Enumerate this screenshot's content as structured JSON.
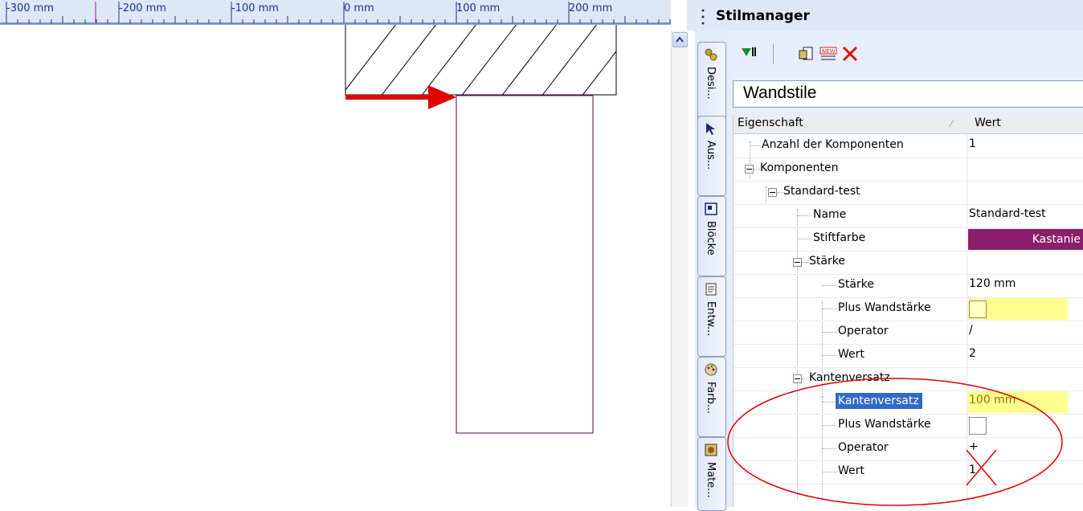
{
  "ruler": {
    "labels": [
      "-300 mm",
      "-200 mm",
      "-100 mm",
      "0 mm",
      "100 mm",
      "200 mm"
    ]
  },
  "scrollbar": {
    "up_icon": "chevron-up-icon"
  },
  "side_tabs": [
    {
      "label": "Desi...",
      "icon": "gears-icon"
    },
    {
      "label": "Aus...",
      "icon": "cursor-icon"
    },
    {
      "label": "Blöcke",
      "icon": "blocks-icon"
    },
    {
      "label": "Entw...",
      "icon": "document-icon"
    },
    {
      "label": "Farb...",
      "icon": "palette-icon"
    },
    {
      "label": "Mate...",
      "icon": "material-icon"
    }
  ],
  "panel": {
    "title": "Stilmanager",
    "style_name": "Wandstile",
    "toolbar": [
      "filter-icon",
      "new-style-icon",
      "rename-icon",
      "delete-icon"
    ]
  },
  "grid": {
    "col_property": "Eigenschaft",
    "col_value": "Wert",
    "rows": [
      {
        "name": "Anzahl der Komponenten",
        "value": "1"
      },
      {
        "name": "Komponenten",
        "value": ""
      },
      {
        "name": "Standard-test",
        "value": ""
      },
      {
        "name": "Name",
        "value": "Standard-test"
      },
      {
        "name": "Stiftfarbe",
        "value": "Kastanie"
      },
      {
        "name": "Stärke",
        "value": ""
      },
      {
        "name": "Stärke",
        "value": "120 mm"
      },
      {
        "name": "Plus Wandstärke",
        "value": ""
      },
      {
        "name": "Operator",
        "value": "/"
      },
      {
        "name": "Wert",
        "value": "2"
      },
      {
        "name": "Kantenversatz",
        "value": ""
      },
      {
        "name": "Kantenversatz",
        "value": "100 mm"
      },
      {
        "name": "Plus Wandstärke",
        "value": ""
      },
      {
        "name": "Operator",
        "value": "+"
      },
      {
        "name": "Wert",
        "value": "1"
      }
    ]
  },
  "colors": {
    "selection": "#316ac5",
    "highlight": "#ffff90",
    "annotation_red": "#e00000",
    "wall_outline": "#7a2a6e",
    "pen_color": "#8b1f6b"
  }
}
